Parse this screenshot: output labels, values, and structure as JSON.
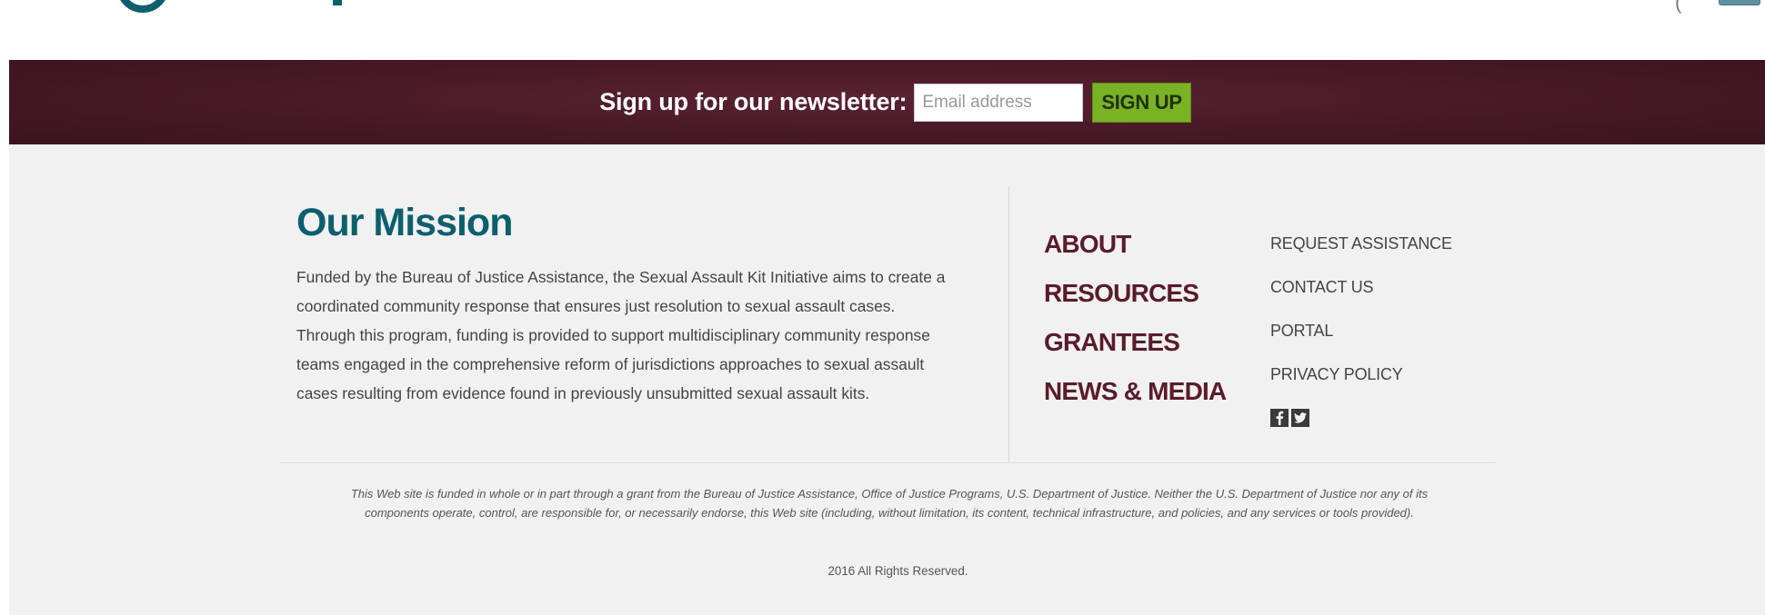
{
  "newsletter": {
    "label": "Sign up for our newsletter:",
    "email_placeholder": "Email address",
    "button_label": "SIGN UP"
  },
  "mission": {
    "title": "Our Mission",
    "text": "Funded by the Bureau of Justice Assistance, the Sexual Assault Kit Initiative aims to create a coordinated community response that ensures just resolution to sexual assault cases. Through this program, funding is provided to support multidisciplinary community response teams engaged in the comprehensive reform of jurisdictions approaches to sexual assault cases resulting from evidence found in previously unsubmitted sexual assault kits."
  },
  "main_nav": {
    "items": [
      {
        "label": "ABOUT"
      },
      {
        "label": "RESOURCES"
      },
      {
        "label": "GRANTEES"
      },
      {
        "label": "NEWS & MEDIA"
      }
    ]
  },
  "secondary_nav": {
    "items": [
      {
        "label": "REQUEST ASSISTANCE"
      },
      {
        "label": "CONTACT US"
      },
      {
        "label": "PORTAL"
      },
      {
        "label": "PRIVACY POLICY"
      }
    ]
  },
  "social": {
    "icons": [
      "facebook-icon",
      "twitter-icon"
    ]
  },
  "footer": {
    "disclaimer": "This Web site is funded in whole or in part through a grant from the Bureau of Justice Assistance, Office of Justice Programs, U.S. Department of Justice. Neither the U.S. Department of Justice nor any of its components operate, control, are responsible for, or necessarily endorse, this Web site (including, without limitation, its content, technical infrastructure, and policies, and any services or tools provided).",
    "copyright": "2016 All Rights Reserved."
  },
  "colors": {
    "brand_teal": "#0d5f6e",
    "nav_maroon": "#5a1b2c",
    "newsletter_band": "#4a1a28",
    "signup_green": "#7ab226",
    "footer_bg": "#f1f1f1"
  }
}
